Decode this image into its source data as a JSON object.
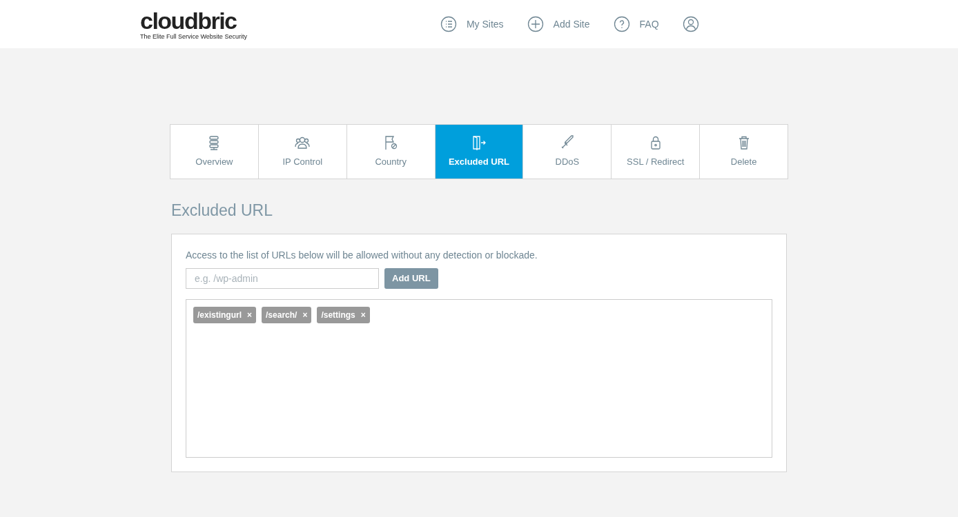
{
  "header": {
    "logo": "cloudbric",
    "tagline": "The Elite Full Service Website Security",
    "nav": [
      {
        "label": "My Sites"
      },
      {
        "label": "Add Site"
      },
      {
        "label": "FAQ"
      }
    ]
  },
  "tabs": [
    {
      "label": "Overview",
      "selected": false
    },
    {
      "label": "IP Control",
      "selected": false
    },
    {
      "label": "Country",
      "selected": false
    },
    {
      "label": "Excluded URL",
      "selected": true
    },
    {
      "label": "DDoS",
      "selected": false
    },
    {
      "label": "SSL / Redirect",
      "selected": false
    },
    {
      "label": "Delete",
      "selected": false
    }
  ],
  "section_title": "Excluded URL",
  "description": "Access to the list of URLs below will be allowed without any detection or blockade.",
  "url_field": {
    "placeholder": "e.g. /wp-admin"
  },
  "add_button": "Add URL",
  "urls": [
    {
      "label": "/existingurl",
      "remove": "×"
    },
    {
      "label": "/search/",
      "remove": "×"
    },
    {
      "label": "/settings",
      "remove": "×"
    }
  ]
}
